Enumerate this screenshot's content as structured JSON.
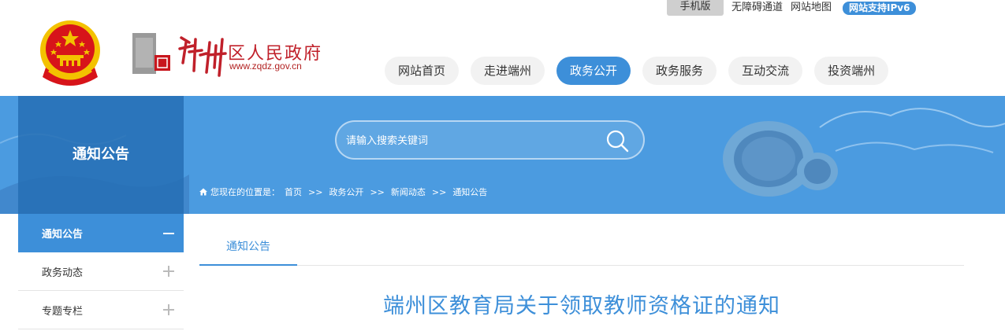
{
  "utility": {
    "mobile": "手机版",
    "accessibility": "无障碍通道",
    "sitemap": "网站地图",
    "ipv6": "网站支持IPv6"
  },
  "logo": {
    "title": "区人民政府",
    "url": "www.zqdz.gov.cn",
    "icon": "duanzhou-logo-icon"
  },
  "nav": {
    "items": [
      {
        "label": "网站首页"
      },
      {
        "label": "走进端州"
      },
      {
        "label": "政务公开"
      },
      {
        "label": "政务服务"
      },
      {
        "label": "互动交流"
      },
      {
        "label": "投资端州"
      }
    ],
    "active_index": 2
  },
  "banner": {
    "section_title": "通知公告",
    "search_placeholder": "请输入搜索关键词"
  },
  "breadcrumb": {
    "prefix": "您现在的位置是：",
    "items": [
      "首页",
      "政务公开",
      "新闻动态",
      "通知公告"
    ],
    "separator": ">>"
  },
  "sidebar": {
    "items": [
      {
        "label": "通知公告",
        "active": true
      },
      {
        "label": "政务动态",
        "active": false
      },
      {
        "label": "专题专栏",
        "active": false
      }
    ]
  },
  "content": {
    "tab": "通知公告",
    "title": "端州区教育局关于领取教师资格证的通知"
  },
  "colors": {
    "accent": "#3d8fd9",
    "banner": "#4b9be0",
    "emblem_red": "#d7141a",
    "emblem_gold": "#f3c200"
  }
}
